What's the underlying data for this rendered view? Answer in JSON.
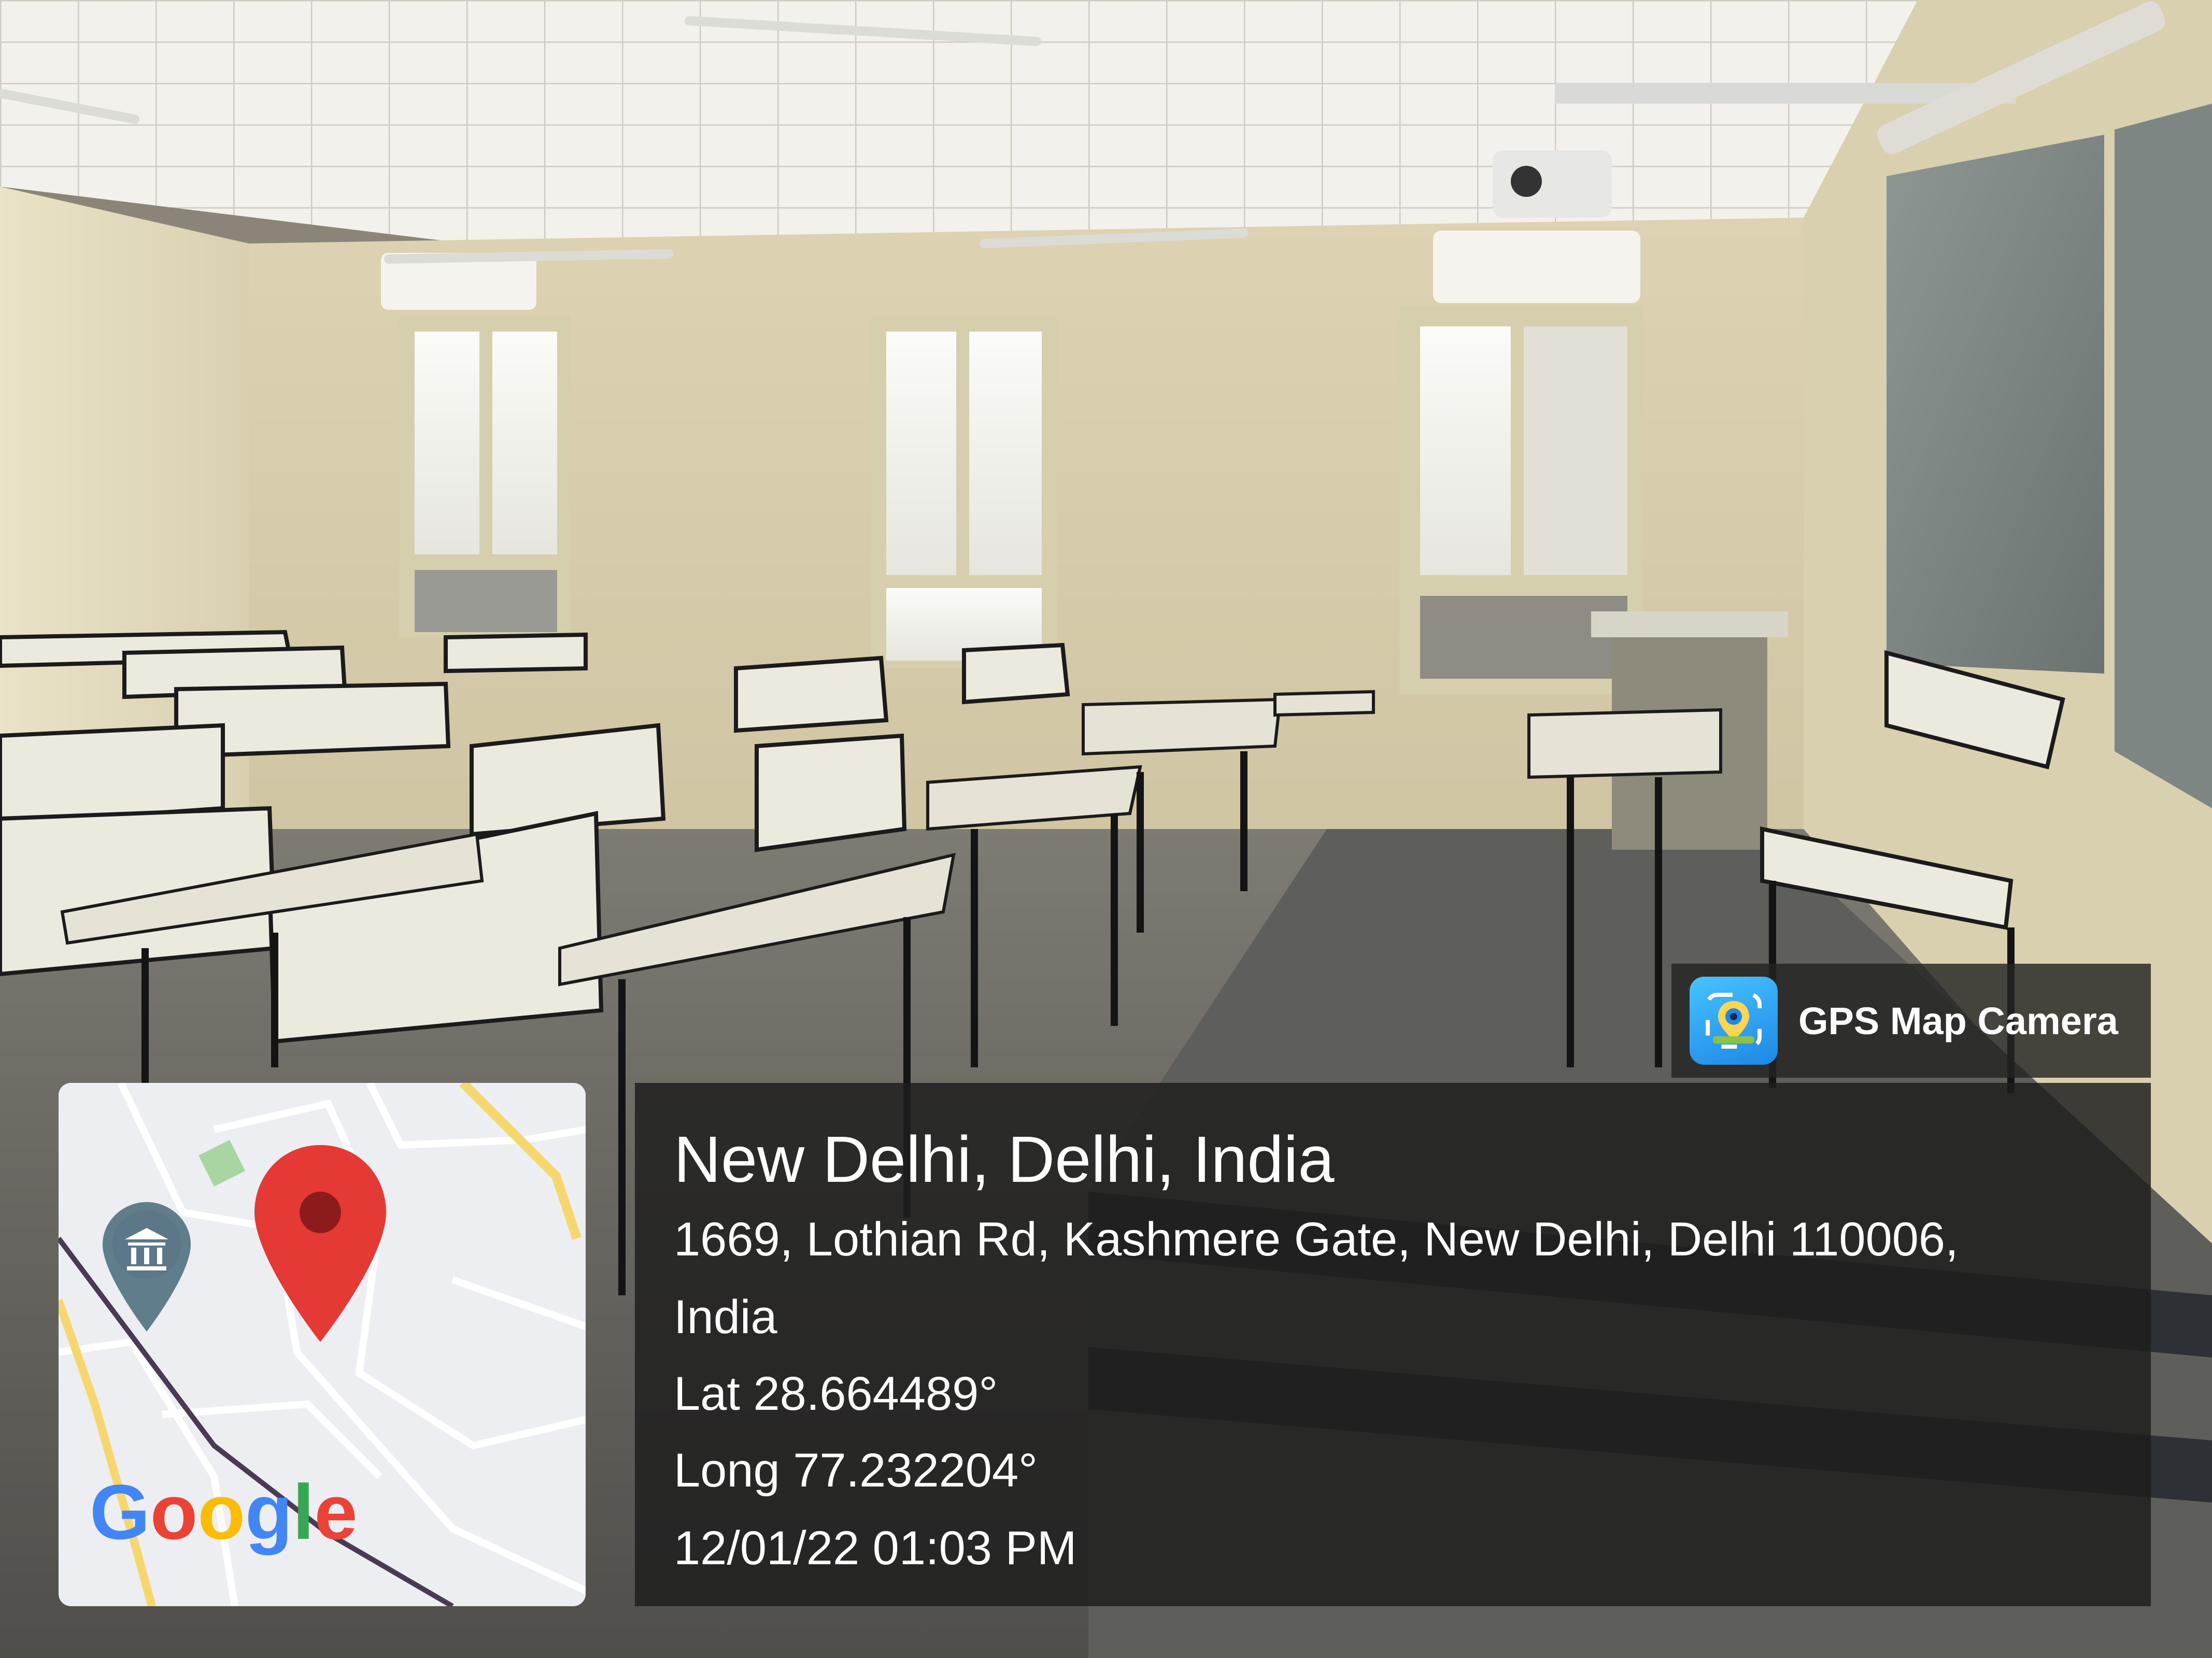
{
  "badge": {
    "app_name": "GPS Map Camera",
    "icon": "gps-camera-app-icon"
  },
  "location": {
    "city_line": "New Delhi, Delhi, India",
    "address_line_1": "1669, Lothian Rd, Kashmere Gate, New Delhi, Delhi 110006,",
    "address_line_2": "India",
    "latitude": "Lat 28.664489°",
    "longitude": "Long 77.232204°",
    "datetime": "12/01/22 01:03 PM"
  },
  "map": {
    "provider_logo": "Google",
    "pin_icon": "location-pin-icon",
    "poi_icon": "museum-icon"
  },
  "colors": {
    "pin_red": "#e53935",
    "poi_slate": "#607d8b",
    "overlay_dark": "#1e1e1e",
    "road_yellow": "#f5d76e"
  }
}
